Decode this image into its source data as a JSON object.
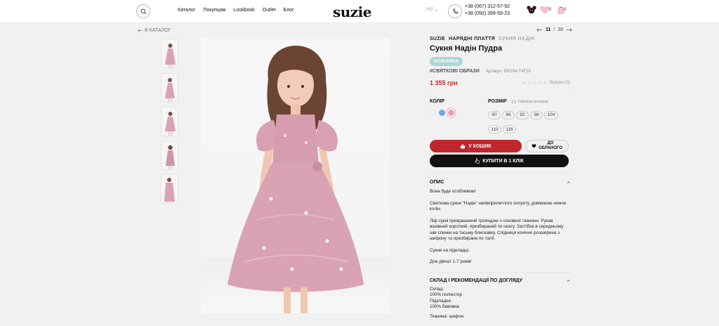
{
  "header": {
    "nav": [
      "Каталог",
      "Покупцям",
      "Lookbook",
      "Outlet",
      "Блог"
    ],
    "logo": "suzie",
    "currency": "УКР",
    "phones": [
      "+38 (067) 312-57-92",
      "+38 (050) 399-59-23"
    ],
    "wishlist_count": "0",
    "cart_count": "0"
  },
  "topbar": {
    "back_label": "В КАТАЛОГ",
    "page_current": "11",
    "page_sep": "/",
    "page_total": "36"
  },
  "product": {
    "breadcrumbs": [
      "SUZIE",
      "НАРЯДНІ ПЛАТТЯ",
      "СУКНЯ НАДІН"
    ],
    "title": "Сукня Надін Пудра",
    "badge": "НОВИНКА",
    "tag": "#СВЯТКОВІ ОБРАЗИ",
    "article": "Артикул: DR194-Y4F20",
    "price": "1 355 грн",
    "reviews": "Відгуки (0)",
    "color_label": "КОЛІР",
    "colors": [
      "#f4f4f4",
      "#6ea8e8",
      "#e6a3ad"
    ],
    "size_label": "РОЗМІР",
    "size_table_label": "Таблиця розмірів",
    "sizes": [
      "80",
      "86",
      "92",
      "98",
      "104",
      "110",
      "116"
    ],
    "cart_button": "У КОШИК",
    "fav_button_line1": "ДО",
    "fav_button_line2": "ОБРАНОГО",
    "buy_one_click": "КУПИТИ В 1 КЛІК"
  },
  "description": {
    "heading": "ОПИС",
    "paragraphs": [
      "Вона буде особливою!",
      "Святкова сукня \"Надін\" напівприлеглого силуету, довжиною нижче колін.",
      "Ліф сукні прикрашений трояндою з основної тканини. Рукав вшивний короткий, призбираний по окату. Застібка в середньому шві спинки на тасьму блискавку. Спідниця конічно розширена з шифону та призбирана по талії.",
      "Сукня на підкладці.",
      "Для дівчат 1-7 років!"
    ]
  },
  "composition": {
    "heading": "СКЛАД І РЕКОМЕНДАЦІЇ ПО ДОГЛЯДУ",
    "lines": [
      "Склад:",
      "100% поліестер",
      "Підкладка:",
      "100% бавовна"
    ],
    "fabric": "Тканина: шифон"
  },
  "colors": {
    "accent": "#c0272d",
    "badge": "#a9d8d2",
    "dress": "#d9a3b4"
  }
}
